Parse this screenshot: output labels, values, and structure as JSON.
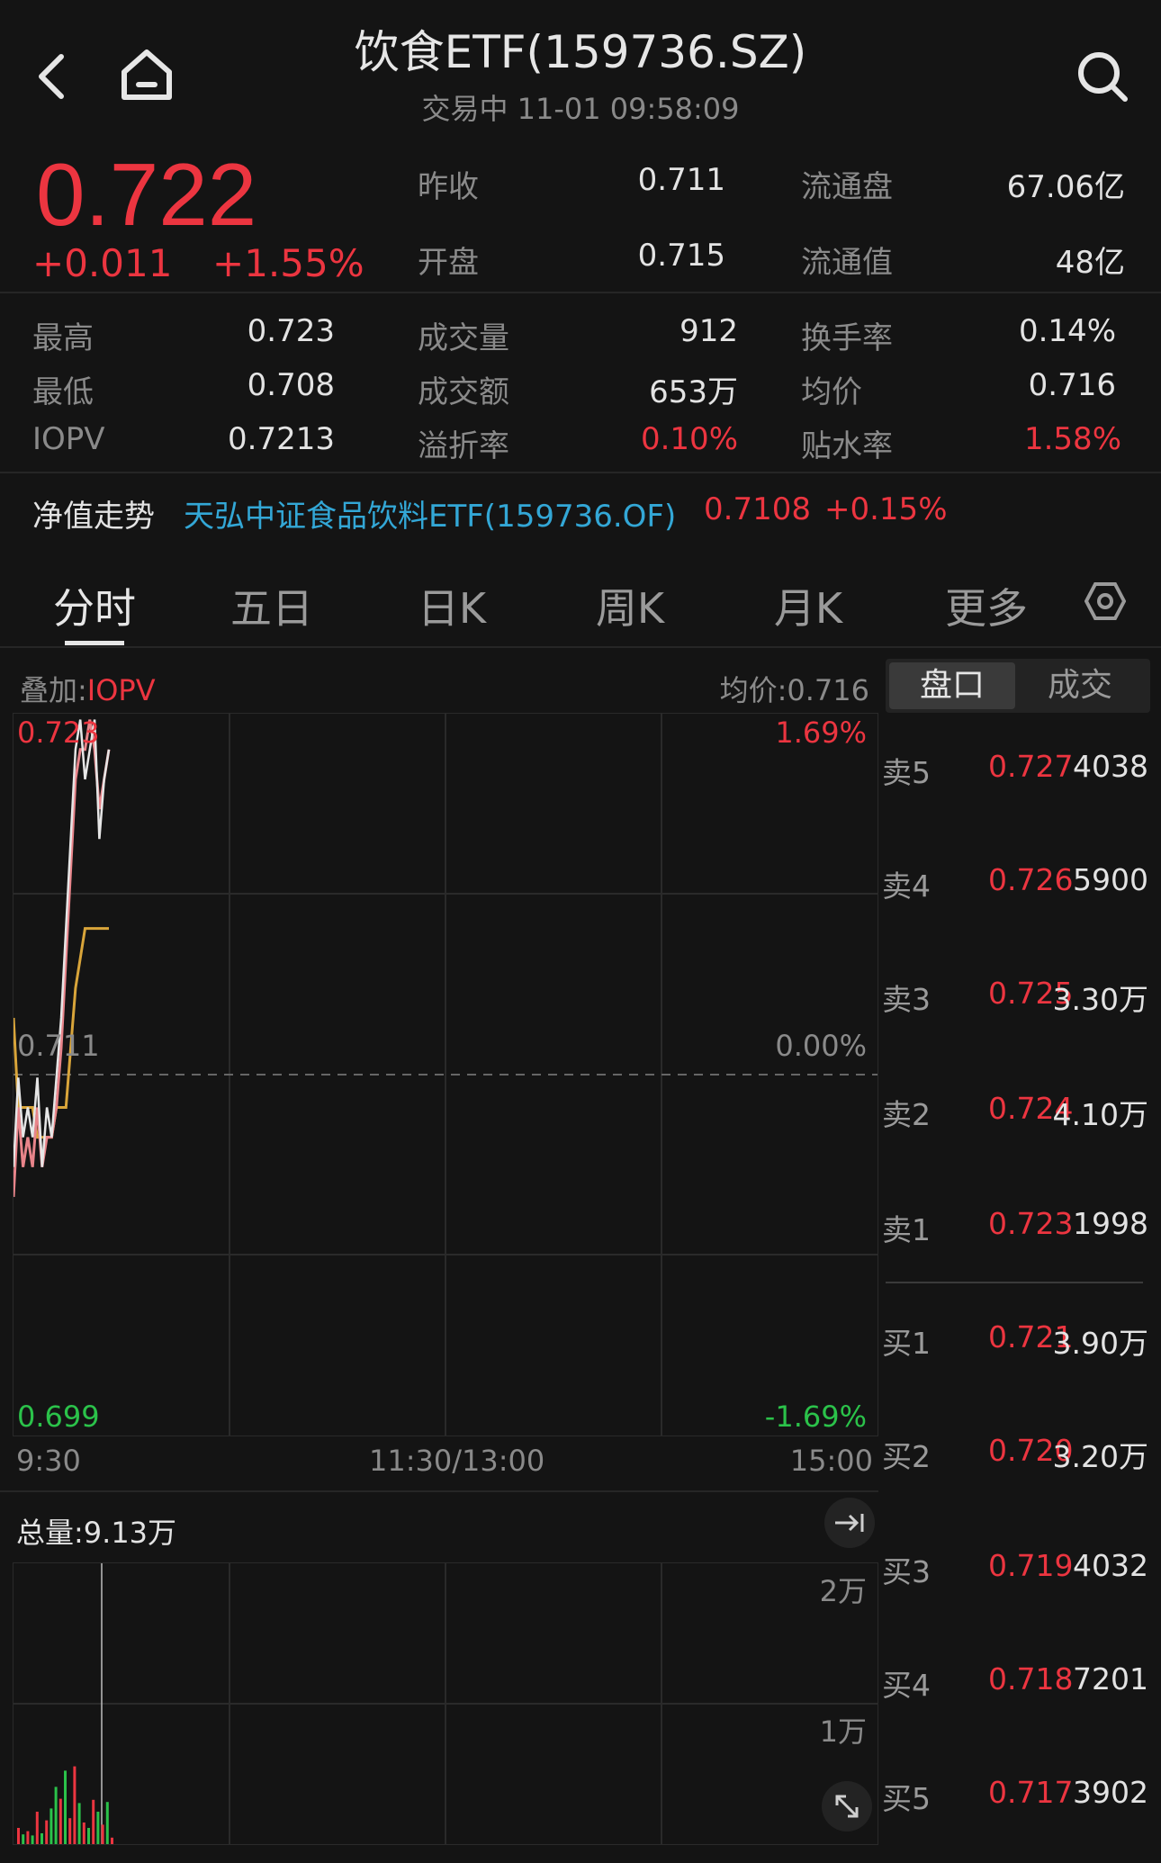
{
  "header": {
    "title": "饮食ETF(159736.SZ)",
    "subtitle": "交易中  11-01 09:58:09"
  },
  "quote": {
    "price": "0.722",
    "change": "+0.011",
    "change_pct": "+1.55%",
    "stats_top": [
      {
        "label": "昨收",
        "value": "0.711"
      },
      {
        "label": "流通盘",
        "value": "67.06亿"
      },
      {
        "label": "开盘",
        "value": "0.715"
      },
      {
        "label": "流通值",
        "value": "48亿"
      }
    ],
    "stats": [
      {
        "label": "最高",
        "value": "0.723"
      },
      {
        "label": "成交量",
        "value": "912"
      },
      {
        "label": "换手率",
        "value": "0.14%"
      },
      {
        "label": "最低",
        "value": "0.708"
      },
      {
        "label": "成交额",
        "value": "653万"
      },
      {
        "label": "均价",
        "value": "0.716"
      },
      {
        "label": "IOPV",
        "value": "0.7213"
      },
      {
        "label": "溢折率",
        "value": "0.10%"
      },
      {
        "label": "贴水率",
        "value": "1.58%"
      }
    ]
  },
  "nav": {
    "label": "净值走势",
    "fund": "天弘中证食品饮料ETF(159736.OF)",
    "value": "0.7108",
    "change": "+0.15%"
  },
  "tabs": [
    "分时",
    "五日",
    "日K",
    "周K",
    "月K",
    "更多"
  ],
  "chart": {
    "overlay_prefix": "叠加:",
    "overlay_value": "IOPV",
    "avg_label": "均价:0.716",
    "y_top": "0.723",
    "y_mid": "0.711",
    "y_bottom": "0.699",
    "pct_top": "1.69%",
    "pct_mid": "0.00%",
    "pct_bottom": "-1.69%",
    "x_start": "9:30",
    "x_mid": "11:30/13:00",
    "x_end": "15:00",
    "total_volume": "总量:9.13万",
    "vol_top": "2万",
    "vol_mid": "1万",
    "price_series": [
      0.708,
      0.711,
      0.709,
      0.71,
      0.709,
      0.711,
      0.708,
      0.71,
      0.709,
      0.711,
      0.713,
      0.716,
      0.719,
      0.722,
      0.723,
      0.721,
      0.722,
      0.723,
      0.719,
      0.721,
      0.722
    ],
    "avg_series": [
      0.713,
      0.71,
      0.71,
      0.71,
      0.71,
      0.709,
      0.709,
      0.709,
      0.709,
      0.71,
      0.71,
      0.71,
      0.712,
      0.714,
      0.715,
      0.716,
      0.716,
      0.716,
      0.716,
      0.716,
      0.716
    ],
    "iopv_series": [
      0.707,
      0.71,
      0.708,
      0.709,
      0.708,
      0.71,
      0.708,
      0.709,
      0.709,
      0.71,
      0.712,
      0.715,
      0.718,
      0.721,
      0.722,
      0.722,
      0.723,
      0.722,
      0.72,
      0.721,
      0.722
    ],
    "volumes": [
      {
        "v": 1500,
        "c": "red"
      },
      {
        "v": 900,
        "c": "green"
      },
      {
        "v": 1200,
        "c": "red"
      },
      {
        "v": 800,
        "c": "green"
      },
      {
        "v": 3000,
        "c": "red"
      },
      {
        "v": 1000,
        "c": "green"
      },
      {
        "v": 2200,
        "c": "red"
      },
      {
        "v": 3300,
        "c": "green"
      },
      {
        "v": 5300,
        "c": "green"
      },
      {
        "v": 4200,
        "c": "red"
      },
      {
        "v": 6800,
        "c": "green"
      },
      {
        "v": 2400,
        "c": "red"
      },
      {
        "v": 7200,
        "c": "red"
      },
      {
        "v": 3800,
        "c": "green"
      },
      {
        "v": 2000,
        "c": "red"
      },
      {
        "v": 1500,
        "c": "green"
      },
      {
        "v": 4100,
        "c": "red"
      },
      {
        "v": 3000,
        "c": "green"
      },
      {
        "v": 1800,
        "c": "red"
      },
      {
        "v": 3900,
        "c": "green"
      },
      {
        "v": 600,
        "c": "red"
      }
    ]
  },
  "orderbook": {
    "tab_active": "盘口",
    "tab_other": "成交",
    "asks": [
      {
        "side": "卖5",
        "price": "0.727",
        "qty": "4038"
      },
      {
        "side": "卖4",
        "price": "0.726",
        "qty": "5900"
      },
      {
        "side": "卖3",
        "price": "0.725",
        "qty": "3.30万"
      },
      {
        "side": "卖2",
        "price": "0.724",
        "qty": "4.10万"
      },
      {
        "side": "卖1",
        "price": "0.723",
        "qty": "1998"
      }
    ],
    "bids": [
      {
        "side": "买1",
        "price": "0.721",
        "qty": "3.90万"
      },
      {
        "side": "买2",
        "price": "0.720",
        "qty": "3.20万"
      },
      {
        "side": "买3",
        "price": "0.719",
        "qty": "4032"
      },
      {
        "side": "买4",
        "price": "0.718",
        "qty": "7201"
      },
      {
        "side": "买5",
        "price": "0.717",
        "qty": "3902"
      }
    ]
  }
}
